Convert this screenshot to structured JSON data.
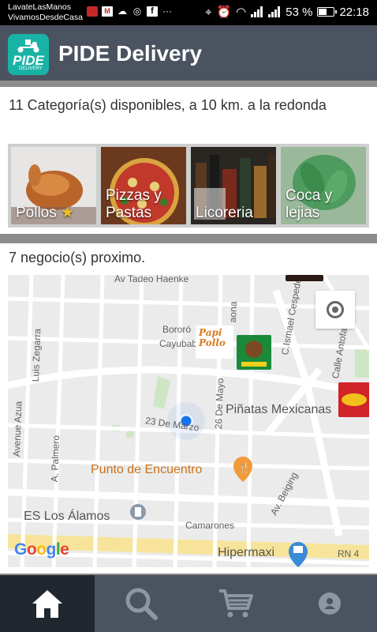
{
  "status_bar": {
    "notif_line1": "LavateLasManos",
    "notif_line2": "VivamosDesdeCasa",
    "battery": "53 %",
    "time": "22:18"
  },
  "app_bar": {
    "title": "PIDE Delivery",
    "logo_text": "PIDE",
    "logo_subtext": "DELIVERY"
  },
  "categories": {
    "summary": "11 Categoría(s) disponibles, a 10 km. a la redonda",
    "items": [
      {
        "label": "Pollos"
      },
      {
        "label": "Pizzas y Pastas"
      },
      {
        "label": "Licoreria"
      },
      {
        "label": "Coca y lejias"
      }
    ]
  },
  "businesses": {
    "summary": "7 negocio(s) proximo."
  },
  "map": {
    "labels": {
      "tadeo": "Av Tadeo Haenke",
      "ismael": "C.Ismael Cespedez",
      "antofagasta": "Calle Antofagasta",
      "luis_zegarra": "Luis Zegarra",
      "azua": "Avenue Azua",
      "palmero": "A. Palmero",
      "bororo": "Bororó",
      "cayubaba": "Cayubaba",
      "mayo": "26 De Mayo",
      "marzo": "23 De Marzo",
      "cabrera": "aona",
      "pinatas": "Piñatas Mexicanas",
      "punto": "Punto de Encuentro",
      "beiging": "Av. Beiging",
      "es_alamos": "ES Los Álamos",
      "camarones": "Camarones",
      "hipermaxi": "Hipermaxi",
      "rn4": "RN 4",
      "papi_pollo": "Papi Pollo"
    },
    "google": "Google"
  },
  "bottom_nav": [
    {
      "name": "home",
      "active": true
    },
    {
      "name": "search",
      "active": false
    },
    {
      "name": "cart",
      "active": false
    },
    {
      "name": "profile",
      "active": false
    }
  ]
}
